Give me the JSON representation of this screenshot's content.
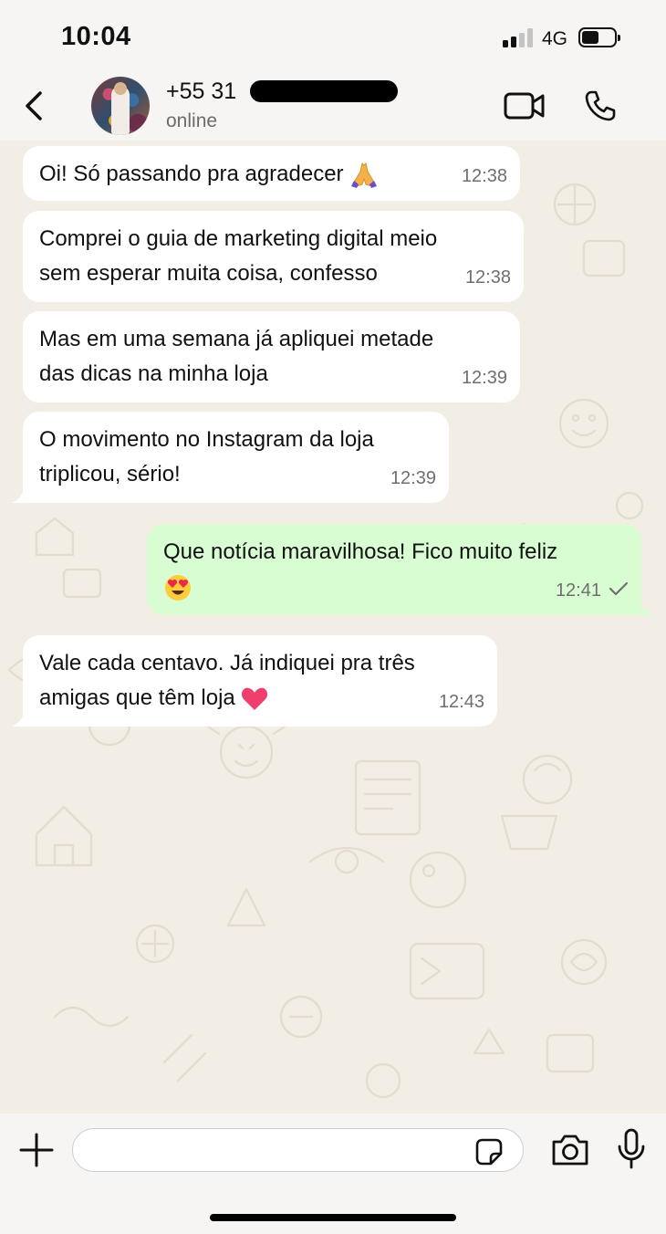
{
  "status_bar": {
    "time": "10:04",
    "network": "4G",
    "signal_bars": 2,
    "signal_bars_total": 4,
    "battery_level": 0.45
  },
  "header": {
    "back_icon": "chevron-left-icon",
    "contact_name": "+55 31",
    "contact_status": "online",
    "video_icon": "video-camera-icon",
    "call_icon": "phone-icon"
  },
  "messages": [
    {
      "direction": "incoming",
      "text": "Oi! Só passando pra agradecer",
      "emoji": "folded-hands",
      "time": "12:38"
    },
    {
      "direction": "incoming",
      "text": "Comprei o guia de marketing digital meio\nsem esperar muita coisa, confesso",
      "time": "12:38"
    },
    {
      "direction": "incoming",
      "text": "Mas em uma semana já apliquei metade\ndas dicas na minha loja",
      "time": "12:39"
    },
    {
      "direction": "incoming",
      "text": "O movimento no Instagram da loja\ntriplicou, sério!",
      "time": "12:39"
    },
    {
      "direction": "outgoing",
      "text": "Que notícia maravilhosa! Fico muito feliz",
      "emoji": "heart-eyes",
      "time": "12:41",
      "status": "sent"
    },
    {
      "direction": "incoming",
      "text": "Vale cada centavo. Já indiquei pra três\namigas que têm loja",
      "emoji": "heart",
      "time": "12:43"
    }
  ],
  "input_bar": {
    "placeholder": "",
    "value": "",
    "plus_icon": "plus-icon",
    "sticker_icon": "sticker-icon",
    "camera_icon": "camera-icon",
    "mic_icon": "microphone-icon"
  },
  "colors": {
    "incoming_bubble": "#ffffff",
    "outgoing_bubble": "#d9fdd3",
    "chat_background": "#f2ede5",
    "bar_background": "#f6f5f3"
  }
}
